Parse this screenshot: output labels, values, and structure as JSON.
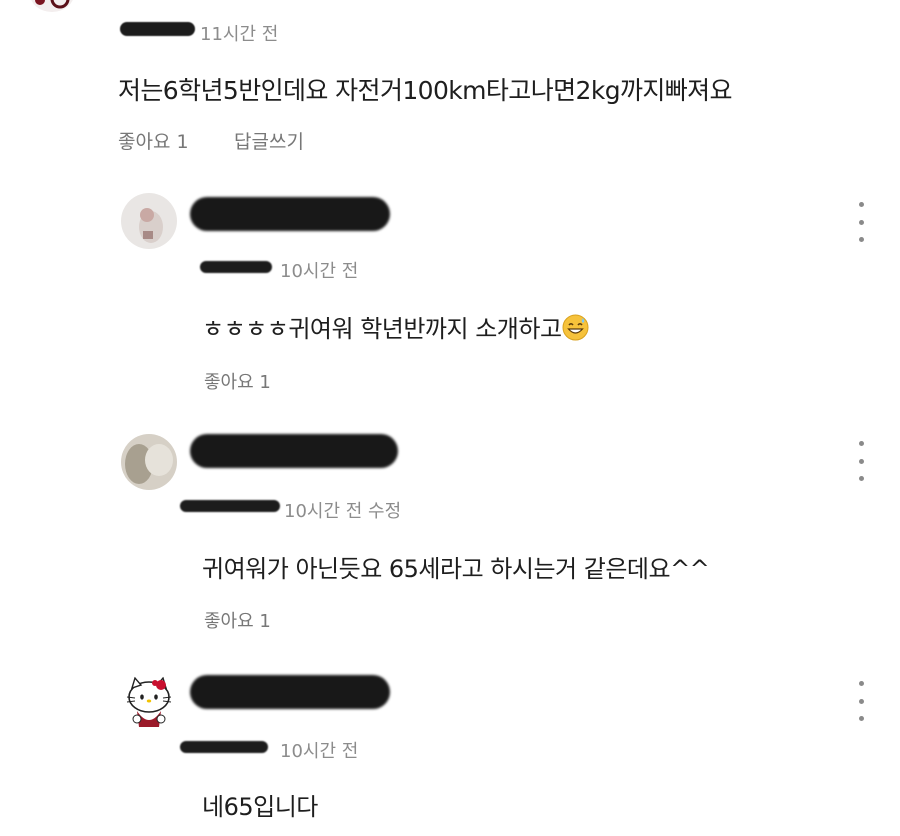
{
  "top_comment": {
    "time": "11시간 전",
    "text": "저는6학년5반인데요 자전거100km타고나면2kg까지빠져요",
    "like": "좋아요 1",
    "reply": "답글쓰기"
  },
  "replies": [
    {
      "time": "10시간 전",
      "text": "ㅎㅎㅎㅎ귀여워 학년반까지 소개하고",
      "emoji": "grinning-sweat-emoji",
      "like": "좋아요 1"
    },
    {
      "time": "10시간 전 수정",
      "text": "귀여워가 아닌듯요 65세라고 하시는거 같은데요^^",
      "like": "좋아요 1"
    },
    {
      "time": "10시간 전",
      "text": "네65입니다"
    }
  ],
  "icons": [
    "kebab-menu-icon",
    "hello-kitty-avatar",
    "avatar-photo"
  ]
}
